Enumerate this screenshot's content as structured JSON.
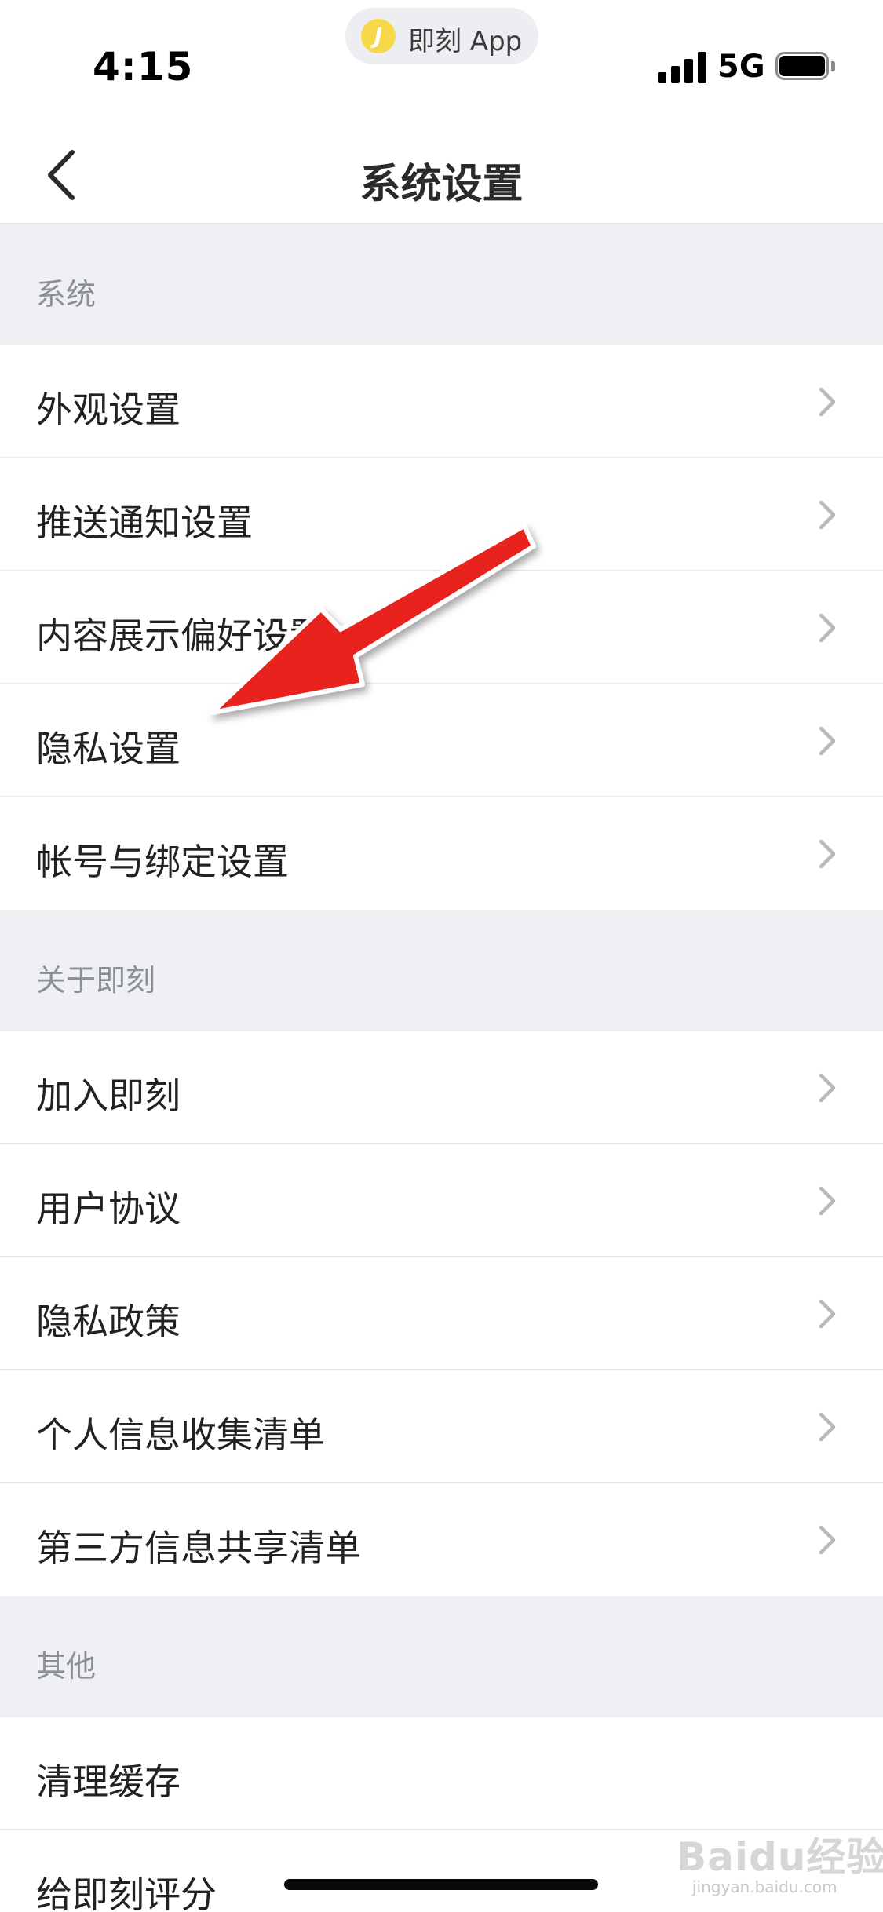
{
  "status_bar": {
    "time": "4:15",
    "app_indicator": "即刻 App",
    "app_icon_letter": "J",
    "network": "5G"
  },
  "nav": {
    "title": "系统设置"
  },
  "sections": [
    {
      "header": "系统",
      "items": [
        {
          "label": "外观设置"
        },
        {
          "label": "推送通知设置"
        },
        {
          "label": "内容展示偏好设置"
        },
        {
          "label": "隐私设置"
        },
        {
          "label": "帐号与绑定设置"
        }
      ]
    },
    {
      "header": "关于即刻",
      "items": [
        {
          "label": "加入即刻"
        },
        {
          "label": "用户协议"
        },
        {
          "label": "隐私政策"
        },
        {
          "label": "个人信息收集清单"
        },
        {
          "label": "第三方信息共享清单"
        }
      ]
    },
    {
      "header": "其他",
      "items": [
        {
          "label": "清理缓存"
        },
        {
          "label": "给即刻评分"
        }
      ]
    }
  ],
  "watermark": {
    "text": "Baidu经验",
    "sub": "jingyan.baidu.com"
  },
  "colors": {
    "accent_arrow": "#e8201a",
    "section_bg": "#eef0f3",
    "chevron": "#b8b8bd"
  },
  "icons": {
    "back": "chevron-left-icon",
    "row_disclosure": "chevron-right-icon"
  }
}
